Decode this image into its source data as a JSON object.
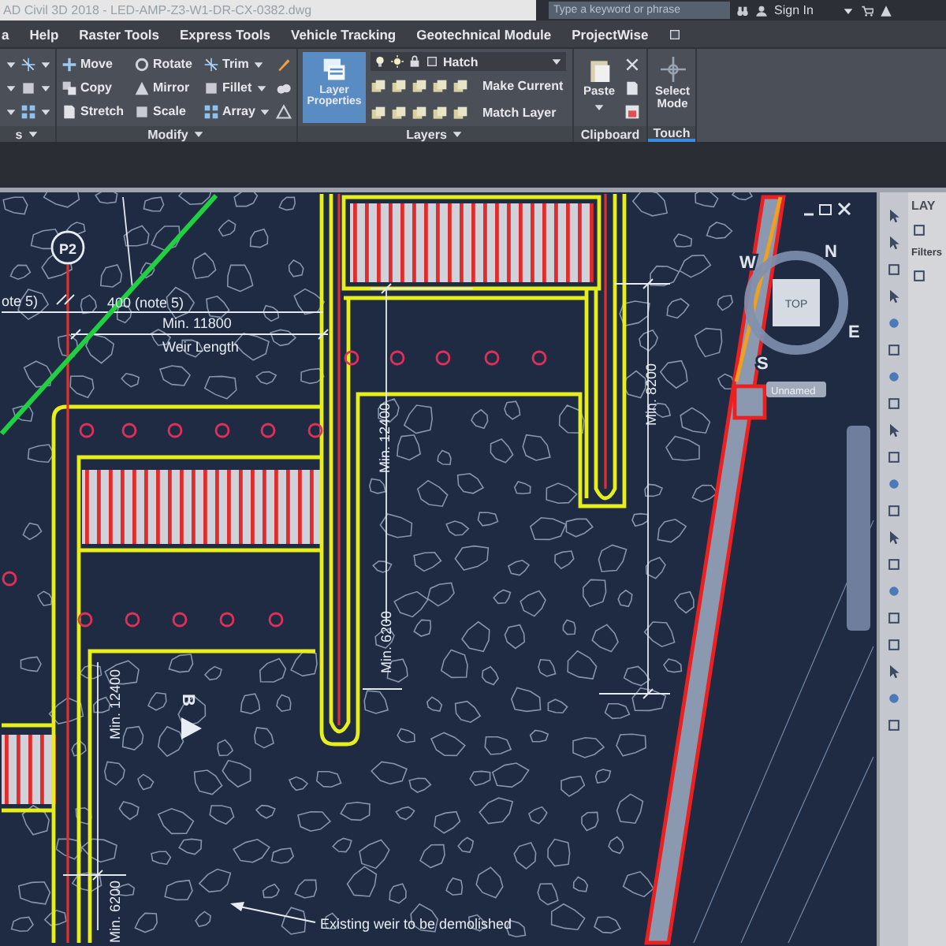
{
  "title_bar": {
    "title": "AD Civil 3D 2018 - LED-AMP-Z3-W1-DR-CX-0382.dwg",
    "search": {
      "placeholder": "Type a keyword or phrase"
    },
    "sign_in": "Sign In"
  },
  "menu": [
    "a",
    "Help",
    "Raster Tools",
    "Express Tools",
    "Vehicle Tracking",
    "Geotechnical Module",
    "ProjectWise"
  ],
  "ribbon": {
    "panels": [
      {
        "kind": "partial",
        "label": "s",
        "expandable": true
      },
      {
        "kind": "tools",
        "label": "Modify",
        "expandable": true,
        "tools": [
          "Move",
          "Rotate",
          "Trim",
          "Copy",
          "Mirror",
          "Fillet",
          "Stretch",
          "Scale",
          "Array"
        ]
      },
      {
        "kind": "layers",
        "label": "Layers",
        "expandable": true,
        "big": {
          "label": "Layer Properties",
          "active": true
        },
        "layer": "Hatch",
        "buttons": [
          "Make Current",
          "Match Layer"
        ]
      },
      {
        "kind": "clipboard",
        "label": "Clipboard",
        "expandable": false,
        "big": {
          "label": "Paste",
          "active": false
        }
      },
      {
        "kind": "touch",
        "label": "Touch",
        "expandable": false,
        "big": {
          "label": "Select Mode",
          "active": false
        }
      }
    ]
  },
  "drawing": {
    "callout": "P2",
    "annotations": [
      {
        "text": "ote 5)",
        "kind": "horizontal"
      },
      {
        "text": "400 (note 5)",
        "kind": "horizontal"
      },
      {
        "text": "Min. 11800",
        "kind": "horizontal"
      },
      {
        "text": "Weir Length",
        "kind": "horizontal"
      },
      {
        "text": "Min. 12400",
        "kind": "vertical"
      },
      {
        "text": "Min. 8200",
        "kind": "vertical"
      },
      {
        "text": "Min. 12400",
        "kind": "vertical"
      },
      {
        "text": "Min. 6200",
        "kind": "vertical"
      },
      {
        "text": "Min. 6200",
        "kind": "vertical"
      }
    ],
    "section_marker": "B",
    "note": "Existing weir to be demolished",
    "viewcube": {
      "face": "TOP",
      "directions": [
        "N",
        "E",
        "S",
        "W"
      ]
    },
    "view_name": "Unnamed"
  },
  "palette": {
    "title": "LAY",
    "filters": "Filters"
  }
}
